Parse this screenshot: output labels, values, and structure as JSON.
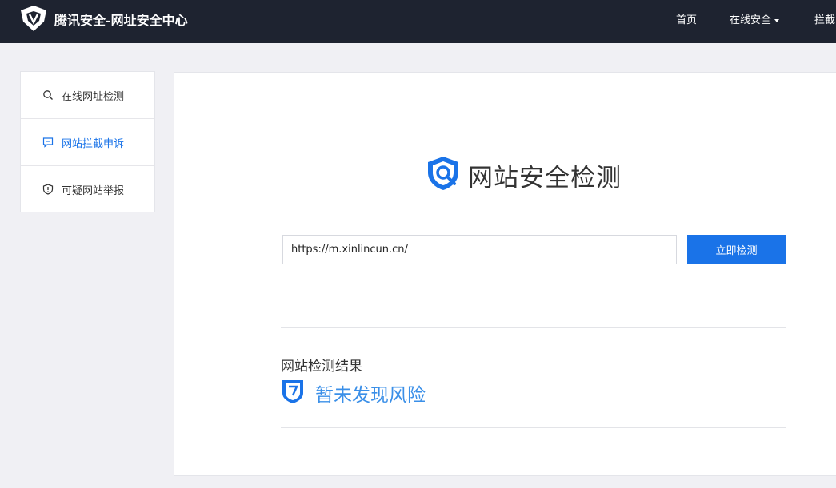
{
  "header": {
    "brand": "腾讯安全-网址安全中心",
    "nav": [
      {
        "label": "首页"
      },
      {
        "label": "在线安全"
      },
      {
        "label": "拦截"
      }
    ]
  },
  "sidebar": {
    "items": [
      {
        "label": "在线网址检测",
        "icon": "search-icon"
      },
      {
        "label": "网站拦截申诉",
        "icon": "chat-icon",
        "active": true
      },
      {
        "label": "可疑网站举报",
        "icon": "shield-alert-icon"
      }
    ]
  },
  "main": {
    "title": "网站安全检测",
    "url_value": "https://m.xinlincun.cn/",
    "check_button": "立即检测",
    "result_label": "网站检测结果",
    "result_status": "暂未发现风险"
  },
  "colors": {
    "header_bg": "#1e2330",
    "accent": "#1a73e8",
    "status": "#3a8fe8"
  }
}
